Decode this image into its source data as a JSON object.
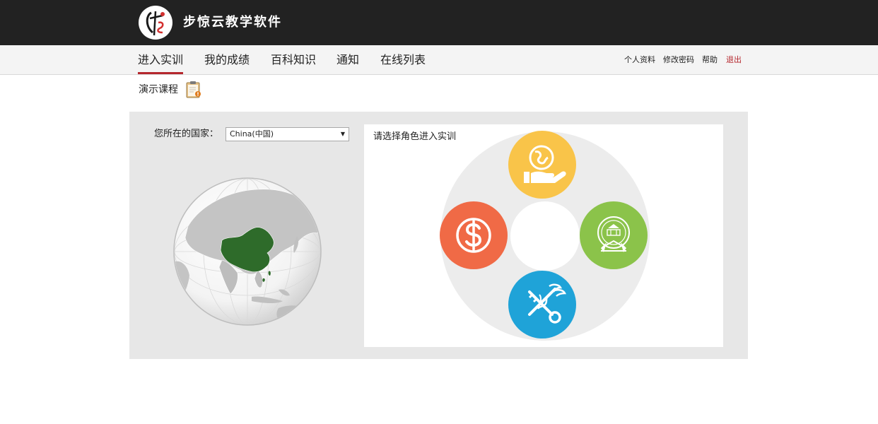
{
  "app": {
    "title": "步惊云教学软件"
  },
  "nav": {
    "items": [
      {
        "label": "进入实训",
        "active": true
      },
      {
        "label": "我的成绩"
      },
      {
        "label": "百科知识"
      },
      {
        "label": "通知"
      },
      {
        "label": "在线列表"
      }
    ],
    "utility": [
      "个人资料",
      "修改密码",
      "帮助",
      "退出"
    ]
  },
  "course": {
    "label": "演示课程"
  },
  "country": {
    "label": "您所在的国家：",
    "selected": "China(中国)"
  },
  "roles": {
    "title": "请选择角色进入实训",
    "items": [
      {
        "position": "top",
        "icon": "globe-in-hand-icon",
        "color": "#f9c449"
      },
      {
        "position": "left",
        "icon": "dollar-coin-icon",
        "color": "#f06a46"
      },
      {
        "position": "right",
        "icon": "national-emblem-icon",
        "color": "#8bc34a"
      },
      {
        "position": "bottom",
        "icon": "customs-key-caduceus-icon",
        "color": "#1fa3d8"
      }
    ]
  },
  "colors": {
    "accent": "#b5272d",
    "topbar": "#222222",
    "highlight_country": "#2e6b2a"
  }
}
